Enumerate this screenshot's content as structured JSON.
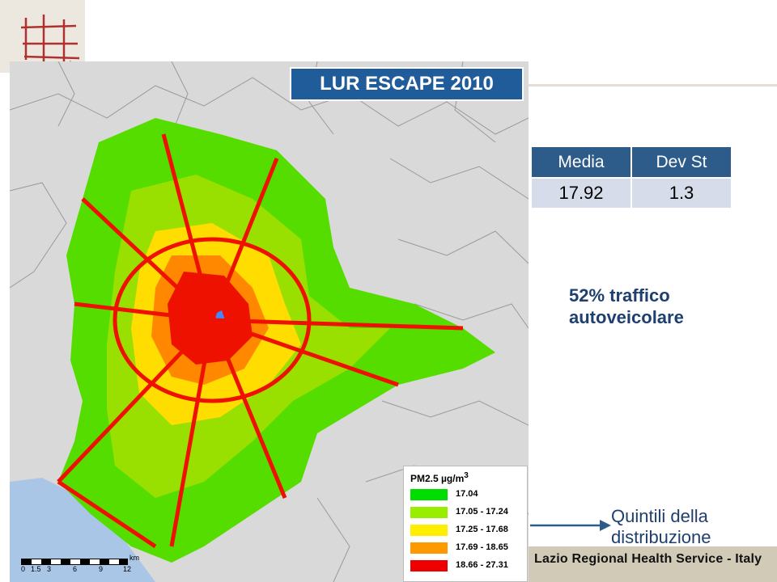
{
  "map_title": "LUR ESCAPE 2010",
  "stats_table": {
    "headers": [
      "Media",
      "Dev St"
    ],
    "values": [
      "17.92",
      "1.3"
    ]
  },
  "note": {
    "line1": "52%  traffico",
    "line2": "autoveicolare"
  },
  "legend": {
    "title": "PM2.5 µg/m",
    "title_sup": "3",
    "items": [
      {
        "label": "17.04",
        "color": "#00dd00"
      },
      {
        "label": "17.05 - 17.24",
        "color": "#99ee00"
      },
      {
        "label": "17.25 - 17.68",
        "color": "#ffee00"
      },
      {
        "label": "17.69 - 18.65",
        "color": "#ff9900"
      },
      {
        "label": "18.66 - 27.31",
        "color": "#ee0000"
      }
    ]
  },
  "scale_bar": {
    "ticks": [
      "0",
      "1.5",
      "3",
      "6",
      "9",
      "12"
    ],
    "unit": "km"
  },
  "quintili": {
    "line1": "Quintili della",
    "line2": "distribuzione"
  },
  "footer": "Lazio Regional Health Service - Italy",
  "colors": {
    "title_bg": "#1f5c99",
    "table_header_bg": "#2e5c8a",
    "table_cell_bg": "#d7dcea",
    "note_text": "#1f3f6e",
    "sea": "#a9c6e6",
    "map_bg": "#d9d9d9"
  }
}
